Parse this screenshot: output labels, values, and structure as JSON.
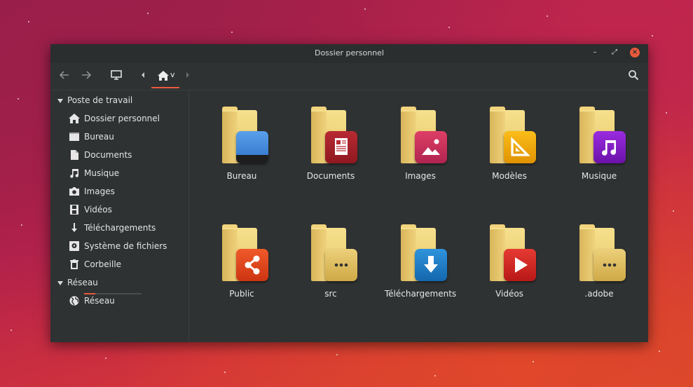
{
  "window": {
    "title": "Dossier personnel"
  },
  "titlebar": {
    "minimize_glyph": "–",
    "maximize_glyph": "⤢",
    "close_glyph": "×"
  },
  "toolbar": {
    "back_icon": "arrow-left-icon",
    "forward_icon": "arrow-right-icon",
    "computer_icon": "monitor-icon",
    "crumb_home_caret": "v",
    "search_icon": "search-icon"
  },
  "sidebar": {
    "sections": [
      {
        "label": "Poste de travail"
      },
      {
        "label": "Réseau"
      }
    ],
    "items": [
      {
        "label": "Dossier personnel",
        "icon": "home-icon"
      },
      {
        "label": "Bureau",
        "icon": "desktop-icon"
      },
      {
        "label": "Documents",
        "icon": "document-icon"
      },
      {
        "label": "Musique",
        "icon": "music-note-icon"
      },
      {
        "label": "Images",
        "icon": "camera-icon"
      },
      {
        "label": "Vidéos",
        "icon": "film-icon"
      },
      {
        "label": "Téléchargements",
        "icon": "download-icon"
      },
      {
        "label": "Système de fichiers",
        "icon": "drive-icon"
      },
      {
        "label": "Corbeille",
        "icon": "trash-icon"
      },
      {
        "label": "Réseau",
        "icon": "globe-icon"
      }
    ]
  },
  "folders": [
    {
      "label": "Bureau",
      "badge": "desktop-badge",
      "color": "#4a8fe0"
    },
    {
      "label": "Documents",
      "badge": "document-badge",
      "color": "#a5202a"
    },
    {
      "label": "Images",
      "badge": "image-badge",
      "color": "#c0306a"
    },
    {
      "label": "Modèles",
      "badge": "template-badge",
      "color": "#f0a800"
    },
    {
      "label": "Musique",
      "badge": "music-badge",
      "color": "#7a1bc0"
    },
    {
      "label": "Public",
      "badge": "share-badge",
      "color": "#e24a1f"
    },
    {
      "label": "src",
      "badge": "generic-badge",
      "color": "#d4b24e"
    },
    {
      "label": "Téléchargements",
      "badge": "download-badge",
      "color": "#1f7fc8"
    },
    {
      "label": "Vidéos",
      "badge": "video-badge",
      "color": "#d42626"
    },
    {
      "label": ".adobe",
      "badge": "generic-badge",
      "color": "#d4b24e"
    }
  ],
  "colors": {
    "accent": "#e95a3c",
    "window_bg": "#2f3233"
  }
}
